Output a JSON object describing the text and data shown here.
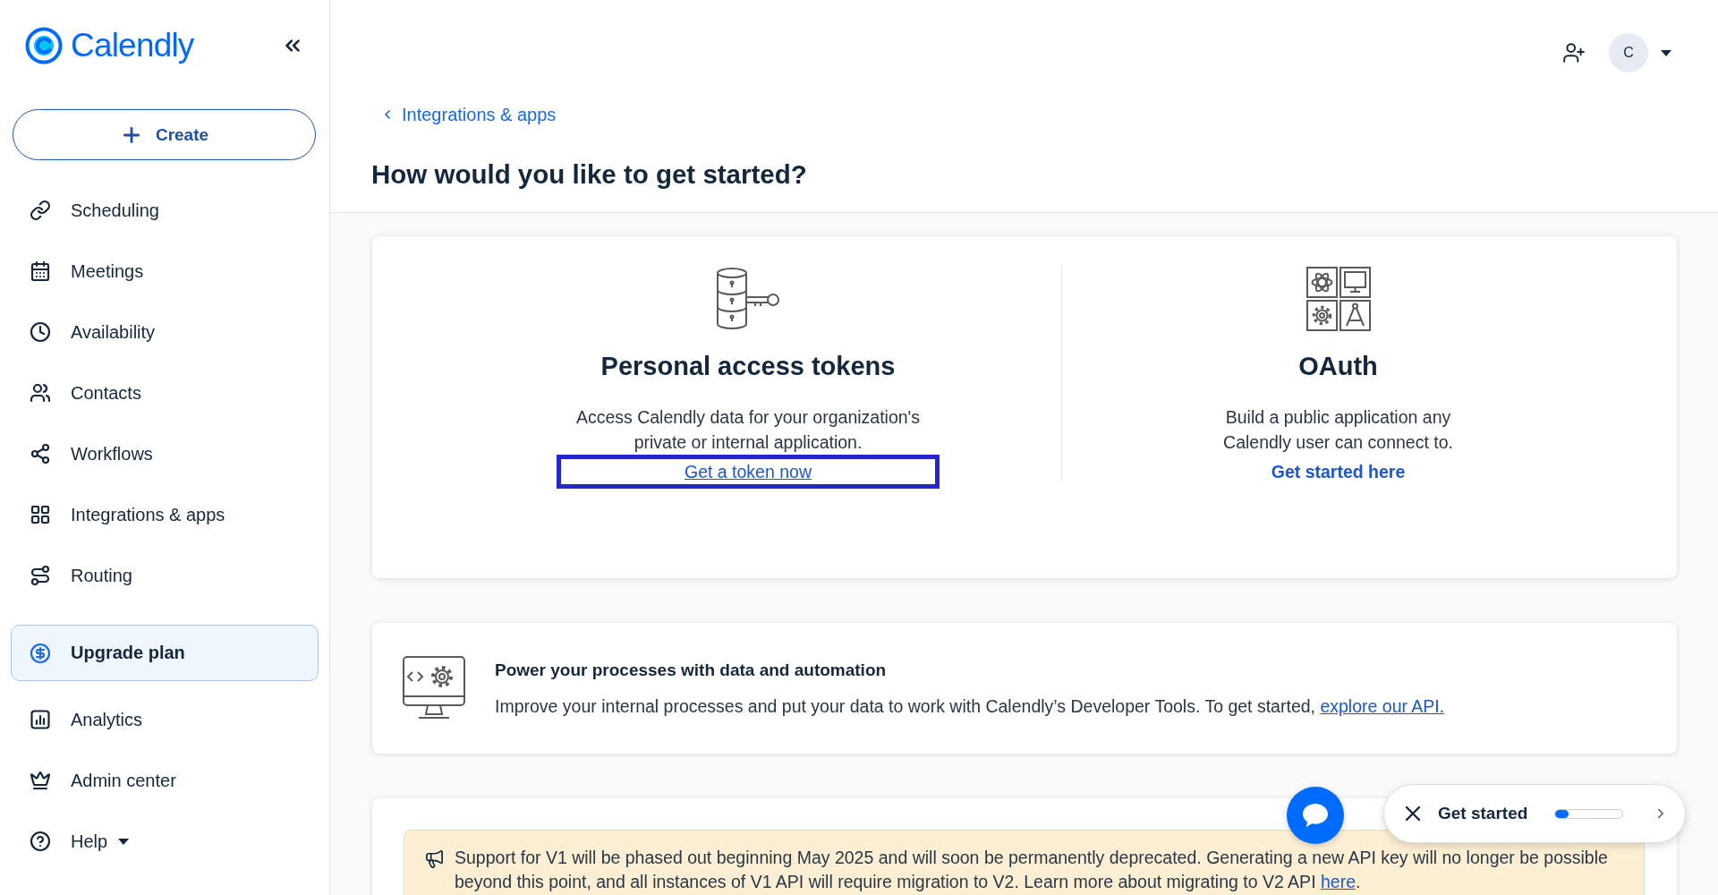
{
  "sidebar": {
    "logo": {
      "text": "Calendly"
    },
    "create_button": {
      "label": "Create"
    },
    "items": [
      {
        "label": "Scheduling",
        "kind": "link",
        "selected": false
      },
      {
        "label": "Meetings",
        "kind": "link",
        "selected": false
      },
      {
        "label": "Availability",
        "kind": "link",
        "selected": false
      },
      {
        "label": "Contacts",
        "kind": "link",
        "selected": false
      },
      {
        "label": "Workflows",
        "kind": "link",
        "selected": false
      },
      {
        "label": "Integrations & apps",
        "kind": "link",
        "selected": false
      },
      {
        "label": "Routing",
        "kind": "link",
        "selected": false
      },
      {
        "label": "Upgrade plan",
        "kind": "upgrade",
        "selected": false
      },
      {
        "label": "Analytics",
        "kind": "link",
        "selected": false
      },
      {
        "label": "Admin center",
        "kind": "link",
        "selected": false
      },
      {
        "label": "Help",
        "kind": "menu",
        "selected": false
      }
    ]
  },
  "header": {
    "avatar": {
      "initial": "C"
    }
  },
  "breadcrumb": {
    "label": "Integrations & apps"
  },
  "title": "How would you like to get started?",
  "options": [
    {
      "title": "Personal access tokens",
      "description": "Access Calendly data for your organization's\nprivate or internal application.",
      "link": {
        "label": "Get a token now",
        "hovered": true,
        "highlighted": true
      }
    },
    {
      "title": "OAuth",
      "description": "Build a public application any\nCalendly user can connect to.",
      "link": {
        "label": "Get started here",
        "hovered": false,
        "highlighted": false
      }
    }
  ],
  "developer_tools": {
    "title": "Power your processes with data and automation",
    "text": "Improve your internal processes and put your data to work with Calendly’s Developer Tools. To get started,",
    "link": "explore our API."
  },
  "notice": {
    "text": "Support for V1 will be phased out beginning May 2025 and will soon be permanently deprecated. Generating a new API key will no longer be possible beyond this point, and all instances of V1 API will require migration to V2. Learn more about migrating to V2 API",
    "link": "here",
    "suffix": "."
  },
  "get_started": {
    "label": "Get started",
    "level": 0.2
  }
}
